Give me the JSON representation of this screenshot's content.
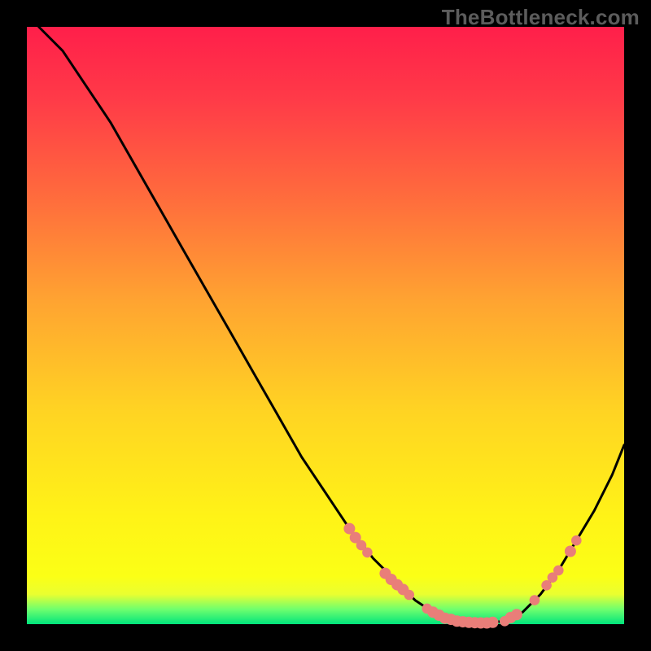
{
  "watermark": "TheBottleneck.com",
  "chart_data": {
    "type": "line",
    "title": "",
    "xlabel": "",
    "ylabel": "",
    "xlim": [
      0,
      100
    ],
    "ylim": [
      0,
      100
    ],
    "grid": false,
    "legend": false,
    "curve": {
      "name": "bottleneck-curve",
      "color": "#000000",
      "x": [
        2,
        6,
        10,
        14,
        18,
        22,
        26,
        30,
        34,
        38,
        42,
        46,
        50,
        54,
        58,
        62,
        65,
        68,
        71,
        74,
        77,
        80,
        83,
        86,
        89,
        92,
        95,
        98,
        100
      ],
      "y": [
        100,
        96,
        90,
        84,
        77,
        70,
        63,
        56,
        49,
        42,
        35,
        28,
        22,
        16,
        11,
        7,
        4,
        2,
        1,
        0.3,
        0.2,
        0.5,
        2,
        5,
        9,
        14,
        19,
        25,
        30
      ]
    },
    "highlight_points": {
      "name": "highlighted-data-points",
      "color": "#e97e79",
      "points": [
        {
          "x": 54,
          "y": 16,
          "r": 1.0
        },
        {
          "x": 55,
          "y": 14.5,
          "r": 1.0
        },
        {
          "x": 56,
          "y": 13.2,
          "r": 0.9
        },
        {
          "x": 57,
          "y": 12.0,
          "r": 0.9
        },
        {
          "x": 60,
          "y": 8.5,
          "r": 1.0
        },
        {
          "x": 61,
          "y": 7.5,
          "r": 1.0
        },
        {
          "x": 62,
          "y": 6.6,
          "r": 1.0
        },
        {
          "x": 63,
          "y": 5.8,
          "r": 1.0
        },
        {
          "x": 64,
          "y": 4.9,
          "r": 0.9
        },
        {
          "x": 67,
          "y": 2.6,
          "r": 0.9
        },
        {
          "x": 68,
          "y": 2.0,
          "r": 1.0
        },
        {
          "x": 69,
          "y": 1.5,
          "r": 1.0
        },
        {
          "x": 70,
          "y": 1.0,
          "r": 1.0
        },
        {
          "x": 71,
          "y": 0.8,
          "r": 1.0
        },
        {
          "x": 72,
          "y": 0.5,
          "r": 1.0
        },
        {
          "x": 73,
          "y": 0.4,
          "r": 1.0
        },
        {
          "x": 74,
          "y": 0.3,
          "r": 1.0
        },
        {
          "x": 75,
          "y": 0.25,
          "r": 1.0
        },
        {
          "x": 76,
          "y": 0.2,
          "r": 1.0
        },
        {
          "x": 77,
          "y": 0.2,
          "r": 1.0
        },
        {
          "x": 78,
          "y": 0.3,
          "r": 1.0
        },
        {
          "x": 80,
          "y": 0.5,
          "r": 0.9
        },
        {
          "x": 81,
          "y": 1.1,
          "r": 1.0
        },
        {
          "x": 82,
          "y": 1.6,
          "r": 1.0
        },
        {
          "x": 85,
          "y": 4.0,
          "r": 0.9
        },
        {
          "x": 87,
          "y": 6.5,
          "r": 0.9
        },
        {
          "x": 88,
          "y": 7.8,
          "r": 0.9
        },
        {
          "x": 89,
          "y": 9.0,
          "r": 0.9
        },
        {
          "x": 91,
          "y": 12.2,
          "r": 1.0
        },
        {
          "x": 92,
          "y": 14.0,
          "r": 0.9
        }
      ]
    }
  }
}
